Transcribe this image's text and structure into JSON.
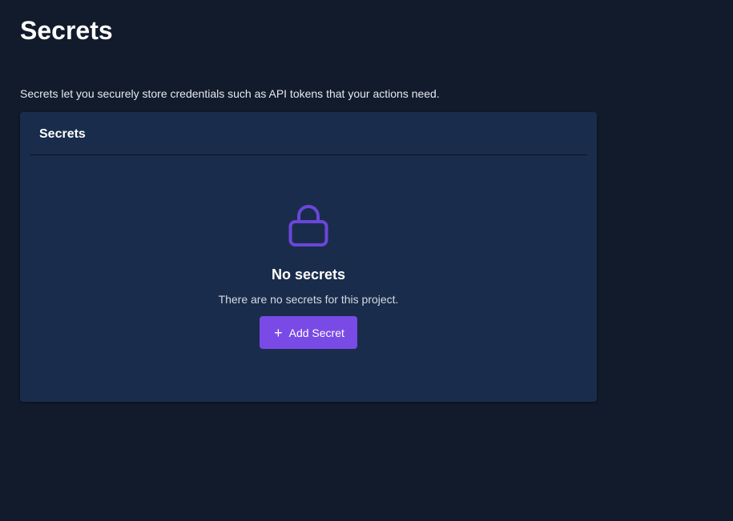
{
  "page": {
    "title": "Secrets",
    "description": "Secrets let you securely store credentials such as API tokens that your actions need."
  },
  "card": {
    "title": "Secrets",
    "empty_state": {
      "icon": "lock-icon",
      "title": "No secrets",
      "message": "There are no secrets for this project.",
      "button_icon": "+",
      "button_label": "Add Secret"
    }
  },
  "colors": {
    "background": "#111b2b",
    "card": "#1a2c4b",
    "accent": "#7a4ae6",
    "icon": "#6a46d9"
  }
}
